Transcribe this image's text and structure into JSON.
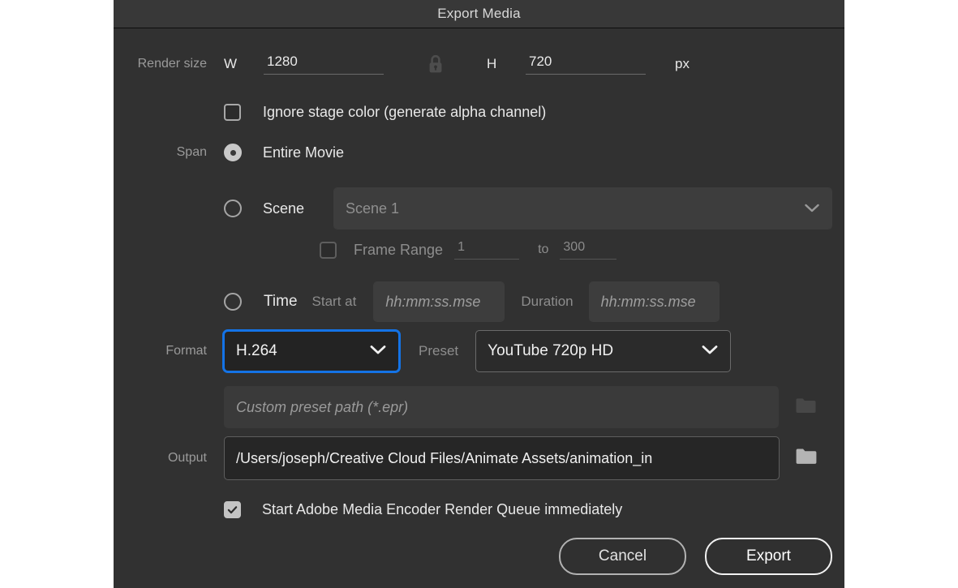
{
  "dialog": {
    "title": "Export Media"
  },
  "render_size": {
    "label": "Render size",
    "width_label": "W",
    "width_value": "1280",
    "lock_icon": "lock-closed-icon",
    "height_label": "H",
    "height_value": "720",
    "unit_label": "px"
  },
  "ignore_stage": {
    "label": "Ignore stage color (generate alpha channel)",
    "checked": false
  },
  "span": {
    "label": "Span",
    "entire_movie": {
      "label": "Entire Movie",
      "selected": true
    },
    "scene": {
      "label": "Scene",
      "selected": false,
      "value": "Scene 1",
      "options": [
        "Scene 1"
      ],
      "caret_icon": "chevron-down-icon"
    },
    "frame_range": {
      "label": "Frame Range",
      "checked": false,
      "from_value": "1",
      "to_label": "to",
      "to_value": "300"
    },
    "time": {
      "label": "Time",
      "selected": false,
      "start_label": "Start at",
      "start_placeholder": "hh:mm:ss.mse",
      "start_value": "",
      "duration_label": "Duration",
      "duration_placeholder": "hh:mm:ss.mse",
      "duration_value": ""
    }
  },
  "format": {
    "label": "Format",
    "value": "H.264",
    "options": [
      "H.264"
    ],
    "caret_icon": "chevron-down-icon"
  },
  "preset": {
    "label": "Preset",
    "value": "YouTube 720p HD",
    "options": [
      "YouTube 720p HD"
    ],
    "caret_icon": "chevron-down-icon"
  },
  "preset_path": {
    "placeholder": "Custom preset path (*.epr)",
    "value": "",
    "browse_icon": "folder-icon"
  },
  "output": {
    "label": "Output",
    "value": "/Users/joseph/Creative Cloud Files/Animate Assets/animation_in",
    "browse_icon": "folder-icon"
  },
  "start_encoder": {
    "label": "Start Adobe Media Encoder Render Queue immediately",
    "checked": true
  },
  "footer": {
    "cancel_label": "Cancel",
    "export_label": "Export"
  },
  "colors": {
    "accent_focus": "#1473e6",
    "dialog_bg": "#313131",
    "titlebar_bg": "#383838",
    "text_primary": "#f0f0f0",
    "text_dim": "#8d8d8d"
  }
}
